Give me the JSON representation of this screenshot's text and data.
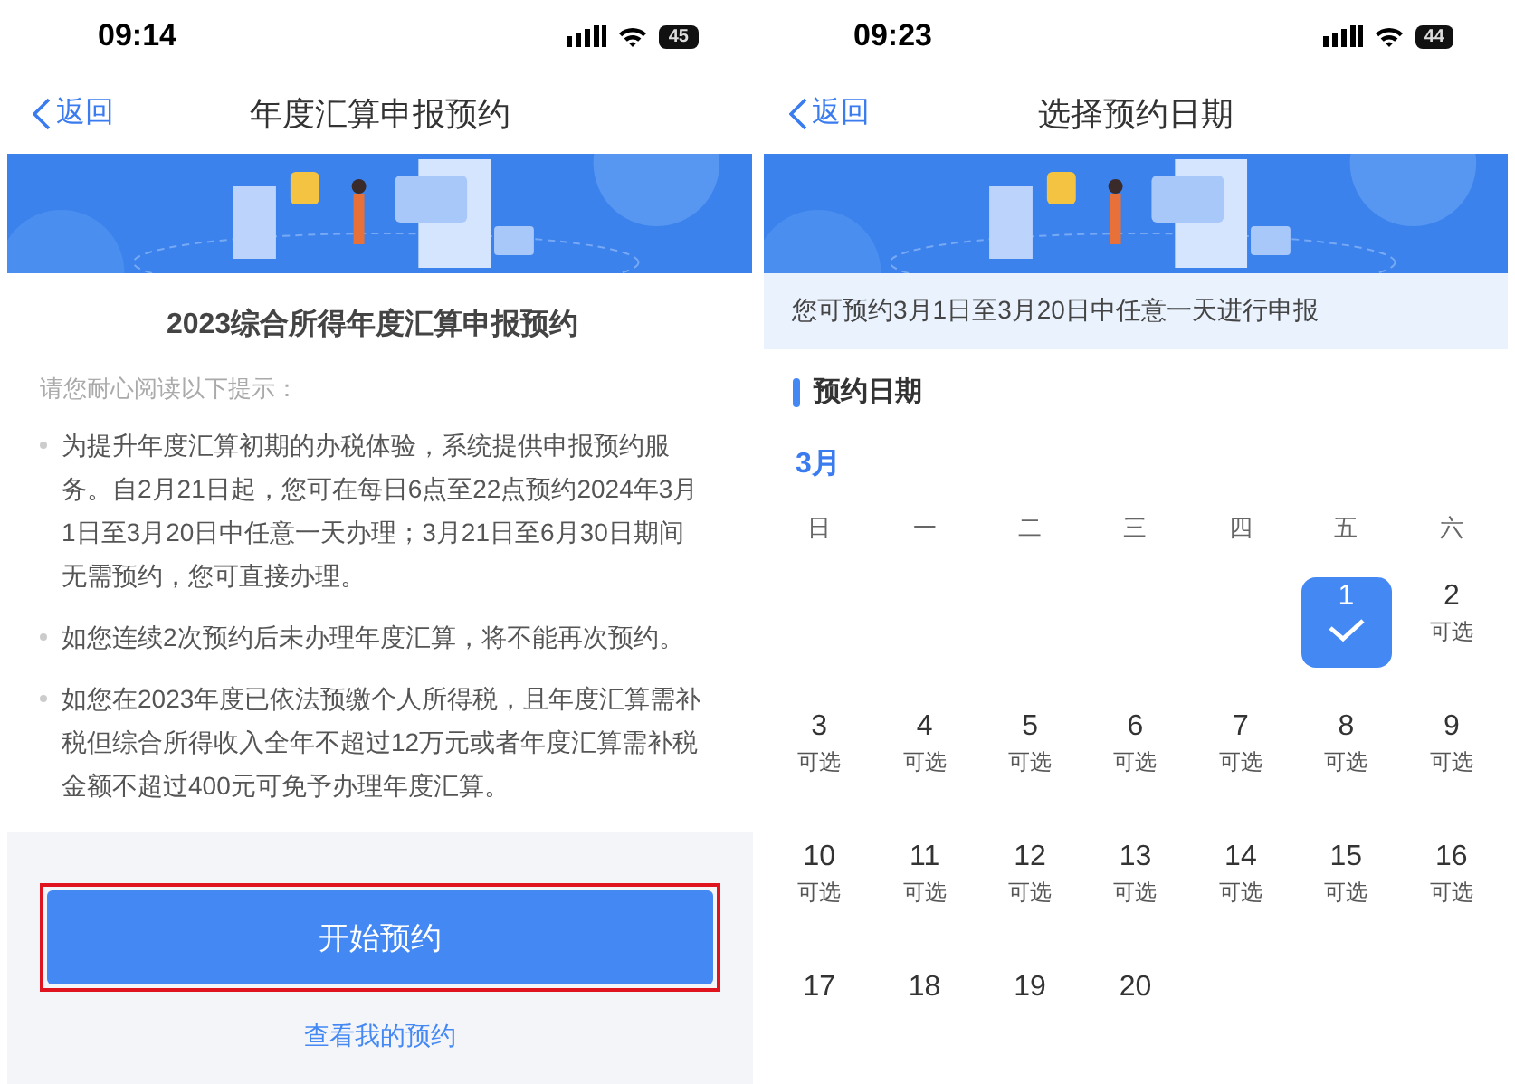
{
  "screens": [
    {
      "status_bar": {
        "time": "09:14",
        "battery": "45"
      },
      "nav": {
        "back": "返回",
        "title": "年度汇算申报预约"
      },
      "notice": {
        "title": "2023综合所得年度汇算申报预约",
        "hint": "请您耐心阅读以下提示：",
        "bullets": [
          "为提升年度汇算初期的办税体验，系统提供申报预约服务。自2月21日起，您可在每日6点至22点预约2024年3月1日至3月20日中任意一天办理；3月21日至6月30日期间无需预约，您可直接办理。",
          "如您连续2次预约后未办理年度汇算，将不能再次预约。",
          "如您在2023年度已依法预缴个人所得税，且年度汇算需补税但综合所得收入全年不超过12万元或者年度汇算需补税金额不超过400元可免予办理年度汇算。"
        ]
      },
      "start_button": {
        "label": "开始预约",
        "highlighted": true
      },
      "link": "查看我的预约"
    },
    {
      "status_bar": {
        "time": "09:23",
        "battery": "44"
      },
      "nav": {
        "back": "返回",
        "title": "选择预约日期"
      },
      "info": "您可预约3月1日至3月20日中任意一天进行申报",
      "section_title": "预约日期",
      "month": "3月",
      "weekdays": [
        "日",
        "一",
        "二",
        "三",
        "四",
        "五",
        "六"
      ],
      "days": [
        {
          "day": "1",
          "selected": true
        },
        {
          "day": "2",
          "note": "可选",
          "selected": false
        },
        {
          "day": "3",
          "note": "可选",
          "selected": false
        },
        {
          "day": "4",
          "note": "可选",
          "selected": false
        },
        {
          "day": "5",
          "note": "可选",
          "selected": false
        },
        {
          "day": "6",
          "note": "可选",
          "selected": false
        },
        {
          "day": "7",
          "note": "可选",
          "selected": false
        },
        {
          "day": "8",
          "note": "可选",
          "selected": false
        },
        {
          "day": "9",
          "note": "可选",
          "selected": false
        },
        {
          "day": "10",
          "note": "可选",
          "selected": false
        },
        {
          "day": "11",
          "note": "可选",
          "selected": false
        },
        {
          "day": "12",
          "note": "可选",
          "selected": false
        },
        {
          "day": "13",
          "note": "可选",
          "selected": false
        },
        {
          "day": "14",
          "note": "可选",
          "selected": false
        },
        {
          "day": "15",
          "note": "可选",
          "selected": false
        },
        {
          "day": "16",
          "note": "可选",
          "selected": false
        },
        {
          "day": "17",
          "selected": false
        },
        {
          "day": "18",
          "selected": false
        },
        {
          "day": "19",
          "selected": false
        },
        {
          "day": "20",
          "selected": false
        }
      ]
    }
  ]
}
